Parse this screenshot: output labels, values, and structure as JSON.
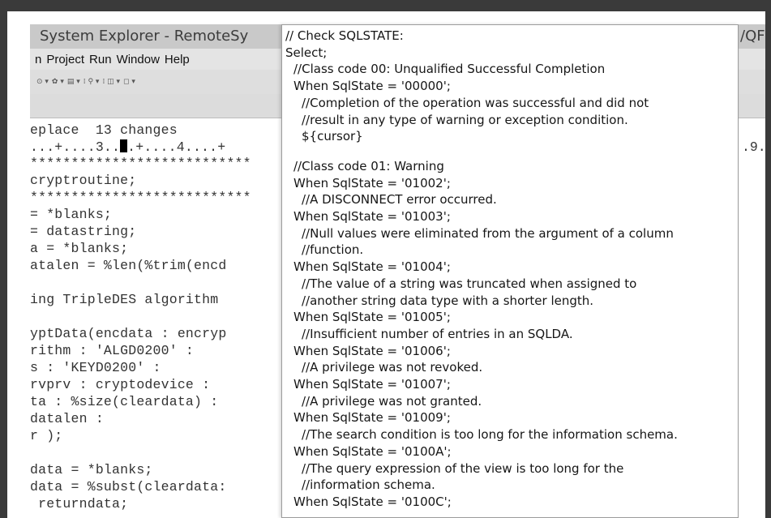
{
  "window": {
    "title": "System Explorer - RemoteSy",
    "title_right_fragment": "/QF"
  },
  "menu": [
    "n",
    "Project",
    "Run",
    "Window",
    "Help"
  ],
  "toolbar": {
    "icons": [
      "run-dropdown-icon",
      "debug-dropdown-icon",
      "tools-dropdown-icon",
      "edit-dropdown-icon",
      "navigate-dropdown-icon",
      "nav-back-icon"
    ]
  },
  "editor": {
    "lines": [
      "eplace  13 changes",
      "...+....3..",
      ".+....4....+",
      "***************************",
      "cryptroutine;",
      "***************************",
      "= *blanks;",
      "= datastring;",
      "a = *blanks;",
      "atalen = %len(%trim(encd",
      "",
      "ing TripleDES algorithm",
      "",
      "yptData(encdata : encryp",
      "rithm : 'ALGD0200' :",
      "s : 'KEYD0200' :",
      "rvprv : cryptodevice :",
      "ta : %size(cleardata) :",
      "datalen :",
      "r );",
      "",
      "data = *blanks;",
      "data = %subst(cleardata:",
      " returndata;"
    ],
    "ruler_right": ".9."
  },
  "popup": {
    "lines": [
      {
        "text": "// Check SQLSTATE:",
        "indent": 0
      },
      {
        "text": "Select;",
        "indent": 0
      },
      {
        "text": "//Class code 00: Unqualified Successful Completion",
        "indent": 1
      },
      {
        "text": "When SqlState = '00000';",
        "indent": 1
      },
      {
        "text": "//Completion of the operation was successful and did not",
        "indent": 2
      },
      {
        "text": "//result in any type of warning or exception condition.",
        "indent": 2
      },
      {
        "text": "${cursor}",
        "indent": 2
      },
      {
        "text": "",
        "indent": 0
      },
      {
        "text": "//Class code 01: Warning",
        "indent": 1
      },
      {
        "text": "When SqlState = '01002';",
        "indent": 1
      },
      {
        "text": "//A DISCONNECT error occurred.",
        "indent": 2
      },
      {
        "text": "When SqlState = '01003';",
        "indent": 1
      },
      {
        "text": "//Null values were eliminated from the argument of a column",
        "indent": 2
      },
      {
        "text": "//function.",
        "indent": 2
      },
      {
        "text": "When SqlState = '01004';",
        "indent": 1
      },
      {
        "text": "//The value of a string was truncated when assigned to",
        "indent": 2
      },
      {
        "text": "//another string data type with a shorter length.",
        "indent": 2
      },
      {
        "text": "When SqlState = '01005';",
        "indent": 1
      },
      {
        "text": "//Insufficient number of entries in an SQLDA.",
        "indent": 2
      },
      {
        "text": "When SqlState = '01006';",
        "indent": 1
      },
      {
        "text": "//A privilege was not revoked.",
        "indent": 2
      },
      {
        "text": "When SqlState = '01007';",
        "indent": 1
      },
      {
        "text": "//A privilege was not granted.",
        "indent": 2
      },
      {
        "text": "When SqlState = '01009';",
        "indent": 1
      },
      {
        "text": "//The search condition is too long for the information schema.",
        "indent": 2
      },
      {
        "text": "When SqlState = '0100A';",
        "indent": 1
      },
      {
        "text": "//The query expression of the view is too long for the",
        "indent": 2
      },
      {
        "text": "//information schema.",
        "indent": 2
      },
      {
        "text": "When SqlState = '0100C';",
        "indent": 1
      }
    ]
  }
}
